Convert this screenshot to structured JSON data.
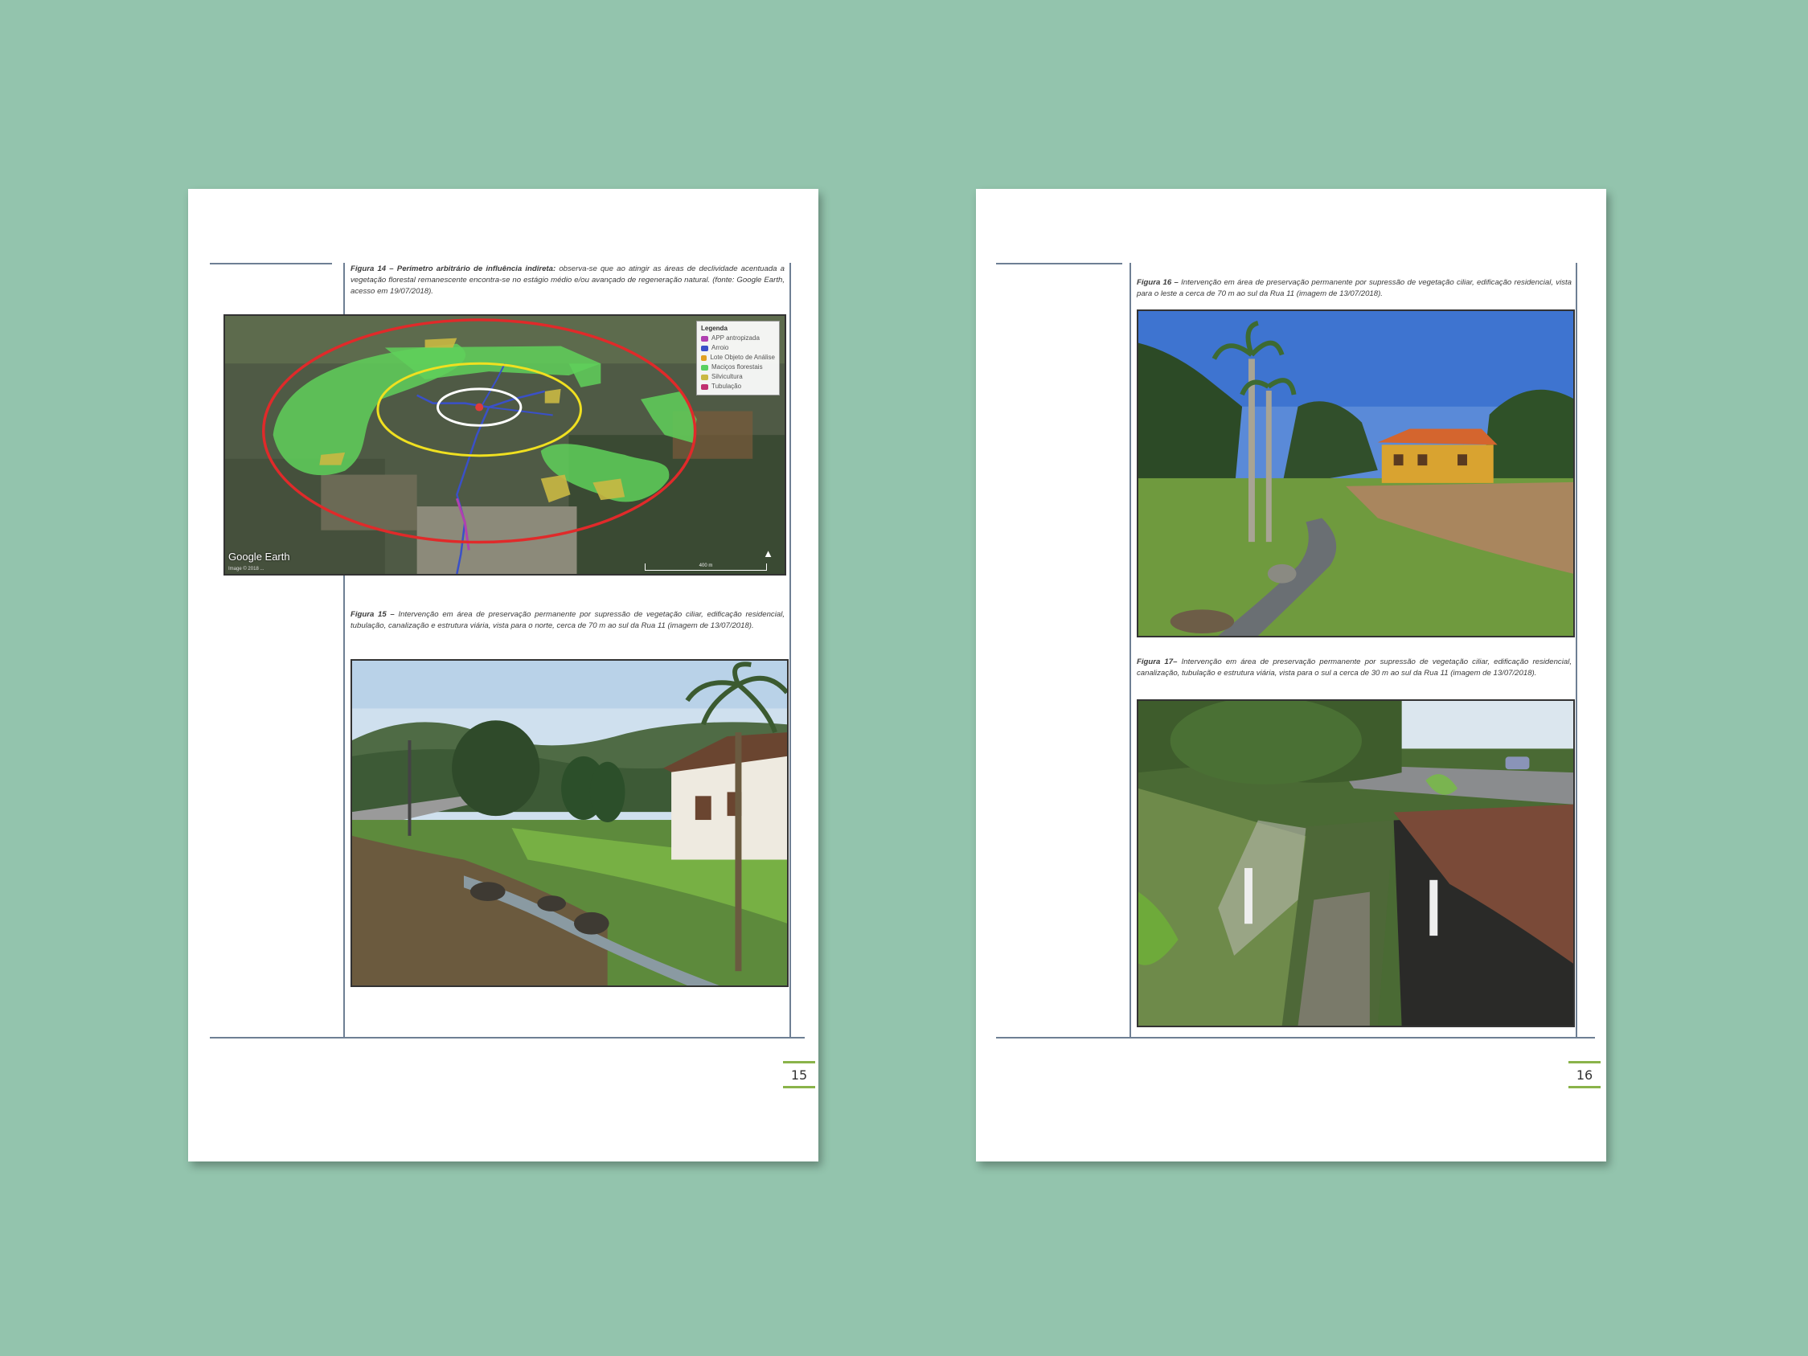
{
  "background_color": "#93c4ad",
  "left_page": {
    "figure14": {
      "caption_label": "Figura 14 – Perímetro arbitrário de influência indireta:",
      "caption_text": "observa-se que ao atingir as áreas de declividade acentuada a vegetação florestal remanescente encontra-se no estágio médio e/ou avançado de regeneração natural. (fonte: Google Earth, acesso em 19/07/2018).",
      "map": {
        "watermark": "Google Earth",
        "copyright": "Image © 2018 ...",
        "scale_label": "400 m",
        "north_icon": "north-arrow-icon",
        "legend": {
          "title": "Legenda",
          "items": [
            {
              "label": "APP antropizada",
              "color": "#b040b0"
            },
            {
              "label": "Arroio",
              "color": "#3a50c8"
            },
            {
              "label": "Lote Objeto de Análise",
              "color": "#e0a020"
            },
            {
              "label": "Maciços florestais",
              "color": "#5ad060"
            },
            {
              "label": "Silvicultura",
              "color": "#c9b843"
            },
            {
              "label": "Tubulação",
              "color": "#c03070"
            }
          ]
        }
      }
    },
    "figure15": {
      "caption_label": "Figura 15 –",
      "caption_text": "Intervenção em área de preservação permanente por supressão de vegetação ciliar, edificação residencial, tubulação, canalização e estrutura viária, vista para o norte, cerca de 70 m ao sul da Rua 11 (imagem de 13/07/2018)."
    },
    "page_number": "15"
  },
  "right_page": {
    "figure16": {
      "caption_label": "Figura 16 –",
      "caption_text": "Intervenção em área de preservação permanente por supressão de vegetação ciliar, edificação residencial, vista para o leste a cerca de 70 m ao sul da Rua 11 (imagem de 13/07/2018)."
    },
    "figure17": {
      "caption_label": "Figura 17–",
      "caption_text": "Intervenção em área de preservação permanente por supressão de vegetação ciliar, edificação residencial, canalização, tubulação e estrutura viária, vista para o sul a cerca de 30 m ao sul da Rua 11 (imagem de 13/07/2018)."
    },
    "page_number": "16"
  },
  "colors": {
    "page_rule": "#6e7f94",
    "page_number_accent": "#8ab34a",
    "ring_outer": "#e02a2a",
    "ring_middle": "#f0e020",
    "ring_inner": "#ffffff"
  }
}
